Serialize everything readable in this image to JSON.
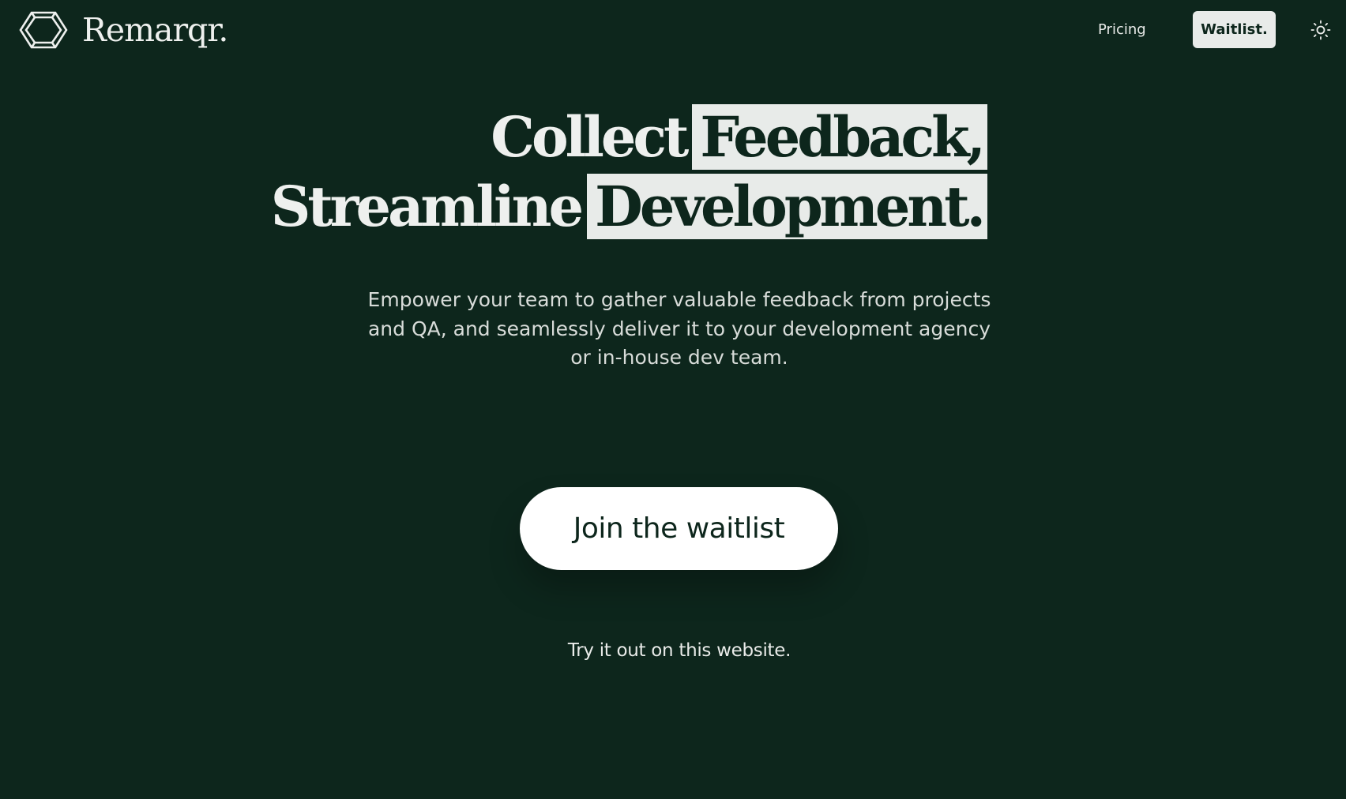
{
  "brand": {
    "name": "Remarqr.",
    "logo_icon": "hexagon-brackets-logo"
  },
  "nav": {
    "pricing_label": "Pricing",
    "waitlist_label": "Waitlist.",
    "theme_icon": "sun-icon"
  },
  "hero": {
    "line1_plain": "Collect",
    "line1_highlight": "Feedback,",
    "line2_plain": "Streamline",
    "line2_highlight": "Development."
  },
  "subtitle": "Empower your team to gather valuable feedback from projects and QA, and seamlessly deliver it to your development agency or in-house dev team.",
  "cta": {
    "label": "Join the waitlist"
  },
  "try_link": "Try it out on this website.",
  "colors": {
    "background": "#0d261c",
    "highlight": "#e8ebe9",
    "text": "#e9ebe9"
  }
}
